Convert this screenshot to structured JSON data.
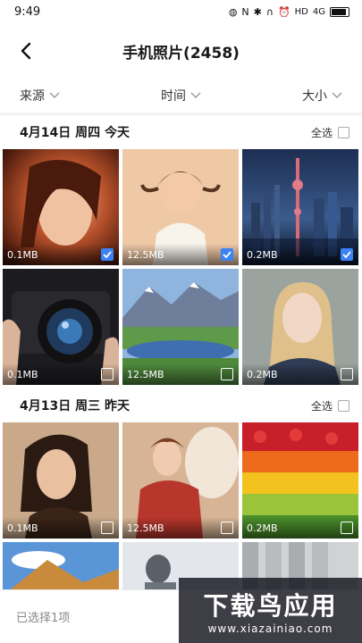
{
  "status_bar": {
    "time": "9:49",
    "network": "HD",
    "signal": "4G"
  },
  "header": {
    "title": "手机照片(2458)",
    "back_icon": "back-arrow-icon"
  },
  "filters": [
    {
      "label": "来源"
    },
    {
      "label": "时间"
    },
    {
      "label": "大小"
    }
  ],
  "sections": [
    {
      "date": "4月14日 周四 今天",
      "select_all_label": "全选",
      "photos": [
        {
          "size": "0.1MB",
          "checked": true
        },
        {
          "size": "12.5MB",
          "checked": true
        },
        {
          "size": "0.2MB",
          "checked": true
        },
        {
          "size": "0.1MB",
          "checked": false
        },
        {
          "size": "12.5MB",
          "checked": false
        },
        {
          "size": "0.2MB",
          "checked": false
        }
      ]
    },
    {
      "date": "4月13日 周三 昨天",
      "select_all_label": "全选",
      "photos": [
        {
          "size": "0.1MB",
          "checked": false
        },
        {
          "size": "12.5MB",
          "checked": false
        },
        {
          "size": "0.2MB",
          "checked": false
        }
      ]
    }
  ],
  "bottom_bar": {
    "selected_text": "已选择1项"
  },
  "watermark": {
    "title": "下载鸟应用",
    "url": "www.xiazainiao.com"
  },
  "colors": {
    "accent": "#3b82f6"
  }
}
